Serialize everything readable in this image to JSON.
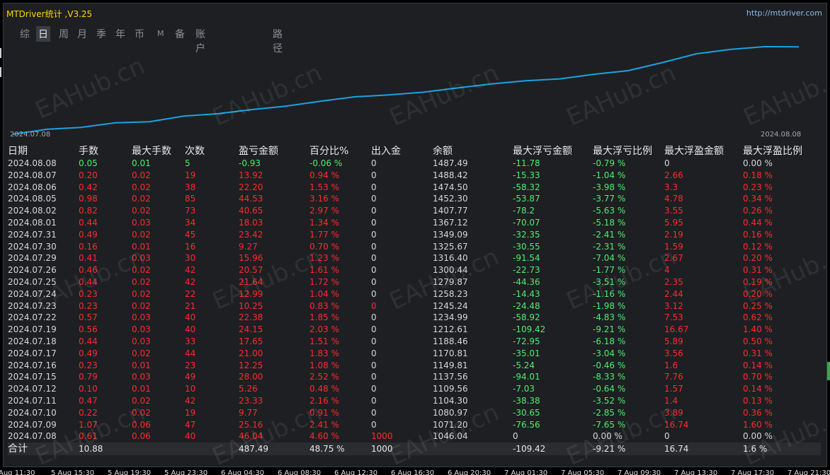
{
  "app": {
    "title": "MTDriver统计 ,V3.25",
    "url": "http://mtdriver.com"
  },
  "tabs": [
    {
      "label": "综",
      "active": false
    },
    {
      "label": "日",
      "active": true
    },
    {
      "label": "周",
      "active": false
    },
    {
      "label": "月",
      "active": false
    },
    {
      "label": "季",
      "active": false
    },
    {
      "label": "年",
      "active": false
    },
    {
      "label": "币",
      "active": false
    },
    {
      "label": "M",
      "active": false
    },
    {
      "label": "备",
      "active": false
    },
    {
      "label": "账户",
      "active": false
    },
    {
      "label": "路径",
      "active": false
    }
  ],
  "chart_data": {
    "type": "line",
    "x_start_label": "2024.07.08",
    "x_end_label": "2024.08.08",
    "series": [
      {
        "values": [
          1046.04,
          1071.2,
          1080.97,
          1104.3,
          1109.56,
          1137.56,
          1149.81,
          1170.81,
          1188.46,
          1212.61,
          1234.99,
          1245.24,
          1258.23,
          1279.87,
          1300.44,
          1316.4,
          1325.67,
          1349.09,
          1367.12,
          1407.77,
          1452.3,
          1474.5,
          1488.42,
          1487.49
        ],
        "color": "#1aa3e0"
      }
    ]
  },
  "table": {
    "headers": [
      "日期",
      "手数",
      "最大手数",
      "次数",
      "盈亏金额",
      "百分比%",
      "出入金",
      "余额",
      "最大浮亏金额",
      "最大浮亏比例",
      "最大浮盈金额",
      "最大浮盈比例"
    ],
    "rows": [
      [
        "2024.08.08",
        "0.05",
        "0.01",
        "5",
        "-0.93",
        "-0.06 %",
        "0",
        "1487.49",
        "-11.78",
        "-0.79 %",
        "0",
        "0.00 %"
      ],
      [
        "2024.08.07",
        "0.20",
        "0.02",
        "19",
        "13.92",
        "0.94 %",
        "0",
        "1488.42",
        "-15.33",
        "-1.04 %",
        "2.66",
        "0.18 %"
      ],
      [
        "2024.08.06",
        "0.42",
        "0.02",
        "38",
        "22.20",
        "1.53 %",
        "0",
        "1474.50",
        "-58.32",
        "-3.98 %",
        "3.3",
        "0.23 %"
      ],
      [
        "2024.08.05",
        "0.98",
        "0.02",
        "85",
        "44.53",
        "3.16 %",
        "0",
        "1452.30",
        "-53.87",
        "-3.77 %",
        "4.78",
        "0.34 %"
      ],
      [
        "2024.08.02",
        "0.82",
        "0.02",
        "73",
        "40.65",
        "2.97 %",
        "0",
        "1407.77",
        "-78.2",
        "-5.63 %",
        "3.55",
        "0.26 %"
      ],
      [
        "2024.08.01",
        "0.44",
        "0.03",
        "34",
        "18.03",
        "1.34 %",
        "0",
        "1367.12",
        "-70.07",
        "-5.18 %",
        "5.95",
        "0.44 %"
      ],
      [
        "2024.07.31",
        "0.49",
        "0.02",
        "45",
        "23.42",
        "1.77 %",
        "0",
        "1349.09",
        "-32.35",
        "-2.41 %",
        "2.19",
        "0.16 %"
      ],
      [
        "2024.07.30",
        "0.16",
        "0.01",
        "16",
        "9.27",
        "0.70 %",
        "0",
        "1325.67",
        "-30.55",
        "-2.31 %",
        "1.59",
        "0.12 %"
      ],
      [
        "2024.07.29",
        "0.41",
        "0.03",
        "30",
        "15.96",
        "1.23 %",
        "0",
        "1316.40",
        "-91.54",
        "-7.04 %",
        "2.67",
        "0.20 %"
      ],
      [
        "2024.07.26",
        "0.46",
        "0.02",
        "42",
        "20.57",
        "1.61 %",
        "0",
        "1300.44",
        "-22.73",
        "-1.77 %",
        "4",
        "0.31 %"
      ],
      [
        "2024.07.25",
        "0.44",
        "0.02",
        "42",
        "21.64",
        "1.72 %",
        "0",
        "1279.87",
        "-44.36",
        "-3.51 %",
        "2.35",
        "0.19 %"
      ],
      [
        "2024.07.24",
        "0.23",
        "0.02",
        "22",
        "12.99",
        "1.04 %",
        "0",
        "1258.23",
        "-14.43",
        "-1.16 %",
        "2.44",
        "0.20 %"
      ],
      [
        "2024.07.23",
        "0.23",
        "0.02",
        "21",
        "10.25",
        "0.83 %",
        "0",
        "1245.24",
        "-24.48",
        "-1.98 %",
        "3.12",
        "0.25 %"
      ],
      [
        "2024.07.22",
        "0.57",
        "0.03",
        "40",
        "22.38",
        "1.85 %",
        "0",
        "1234.99",
        "-58.92",
        "-4.83 %",
        "7.53",
        "0.62 %"
      ],
      [
        "2024.07.19",
        "0.56",
        "0.03",
        "40",
        "24.15",
        "2.03 %",
        "0",
        "1212.61",
        "-109.42",
        "-9.21 %",
        "16.67",
        "1.40 %"
      ],
      [
        "2024.07.18",
        "0.44",
        "0.03",
        "33",
        "17.65",
        "1.51 %",
        "0",
        "1188.46",
        "-72.95",
        "-6.18 %",
        "5.89",
        "0.50 %"
      ],
      [
        "2024.07.17",
        "0.49",
        "0.02",
        "44",
        "21.00",
        "1.83 %",
        "0",
        "1170.81",
        "-35.01",
        "-3.04 %",
        "3.56",
        "0.31 %"
      ],
      [
        "2024.07.16",
        "0.23",
        "0.01",
        "23",
        "12.25",
        "1.08 %",
        "0",
        "1149.81",
        "-5.24",
        "-0.46 %",
        "1.6",
        "0.14 %"
      ],
      [
        "2024.07.15",
        "0.79",
        "0.03",
        "49",
        "28.00",
        "2.52 %",
        "0",
        "1137.56",
        "-94.01",
        "-8.33 %",
        "7.76",
        "0.70 %"
      ],
      [
        "2024.07.12",
        "0.10",
        "0.01",
        "10",
        "5.26",
        "0.48 %",
        "0",
        "1109.56",
        "-7.03",
        "-0.64 %",
        "1.57",
        "0.14 %"
      ],
      [
        "2024.07.11",
        "0.47",
        "0.02",
        "42",
        "23.33",
        "2.16 %",
        "0",
        "1104.30",
        "-38.38",
        "-3.52 %",
        "1.4",
        "0.13 %"
      ],
      [
        "2024.07.10",
        "0.22",
        "0.02",
        "19",
        "9.77",
        "0.91 %",
        "0",
        "1080.97",
        "-30.65",
        "-2.85 %",
        "3.89",
        "0.36 %"
      ],
      [
        "2024.07.09",
        "1.07",
        "0.06",
        "47",
        "25.16",
        "2.41 %",
        "0",
        "1071.20",
        "-76.56",
        "-7.65 %",
        "16.74",
        "1.60 %"
      ],
      [
        "2024.07.08",
        "0.61",
        "0.06",
        "40",
        "46.04",
        "4.60 %",
        "1000",
        "1046.04",
        "0",
        "0.00 %",
        "0",
        "0.00 %"
      ]
    ],
    "total": [
      "合计",
      "10.88",
      "",
      "",
      "487.49",
      "48.75 %",
      "1000",
      "",
      "-109.42",
      "-9.21 %",
      "16.74",
      "1.6 %"
    ]
  },
  "watermark": "EAHub.cn",
  "x_axis_labels": [
    "Aug 11:30",
    "5 Aug 15:30",
    "5 Aug 19:30",
    "5 Aug 23:30",
    "6 Aug 04:30",
    "6 Aug 08:30",
    "6 Aug 12:30",
    "6 Aug 16:30",
    "6 Aug 20:30",
    "7 Aug 01:30",
    "7 Aug 05:30",
    "7 Aug 09:30",
    "7 Aug 13:30",
    "7 Aug 17:30",
    "7 Aug 21:30"
  ]
}
